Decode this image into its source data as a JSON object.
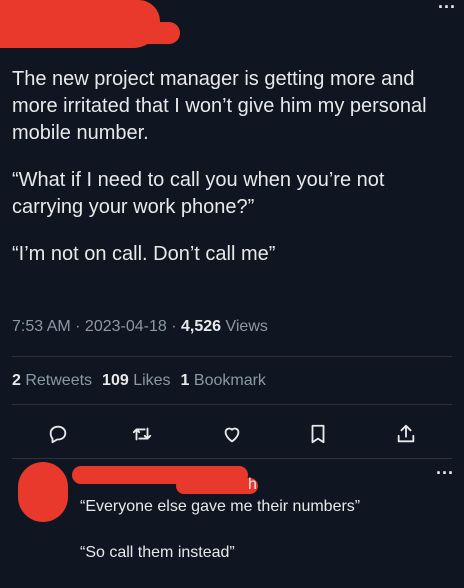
{
  "header": {
    "more_label": "..."
  },
  "tweet": {
    "paragraphs": [
      "The new project manager is getting more and more irritated that I won’t give him my personal mobile number.",
      "“What if I need to call you when you’re not carrying your work phone?”",
      "“I’m not on call. Don’t call me”"
    ],
    "time": "7:53 AM",
    "sep1": " · ",
    "date": "2023-04-18",
    "sep2": " · ",
    "views_count": "4,526",
    "views_label": " Views"
  },
  "stats": {
    "retweets_count": "2",
    "retweets_label": " Retweets",
    "likes_count": "109",
    "likes_label": " Likes",
    "bookmarks_count": "1",
    "bookmarks_label": " Bookmark"
  },
  "actions": [
    {
      "icon": "reply-icon"
    },
    {
      "icon": "retweet-icon"
    },
    {
      "icon": "like-icon"
    },
    {
      "icon": "bookmark-icon"
    },
    {
      "icon": "share-icon"
    }
  ],
  "reply": {
    "visible_name_fragment": "h",
    "more_label": "...",
    "paragraphs": [
      "“Everyone else gave me their numbers”",
      "“So call them instead”"
    ]
  },
  "colors": {
    "background": "#0f1621",
    "text": "#e7e9ea",
    "muted": "#8b98a5",
    "redaction": "#e8392c"
  }
}
